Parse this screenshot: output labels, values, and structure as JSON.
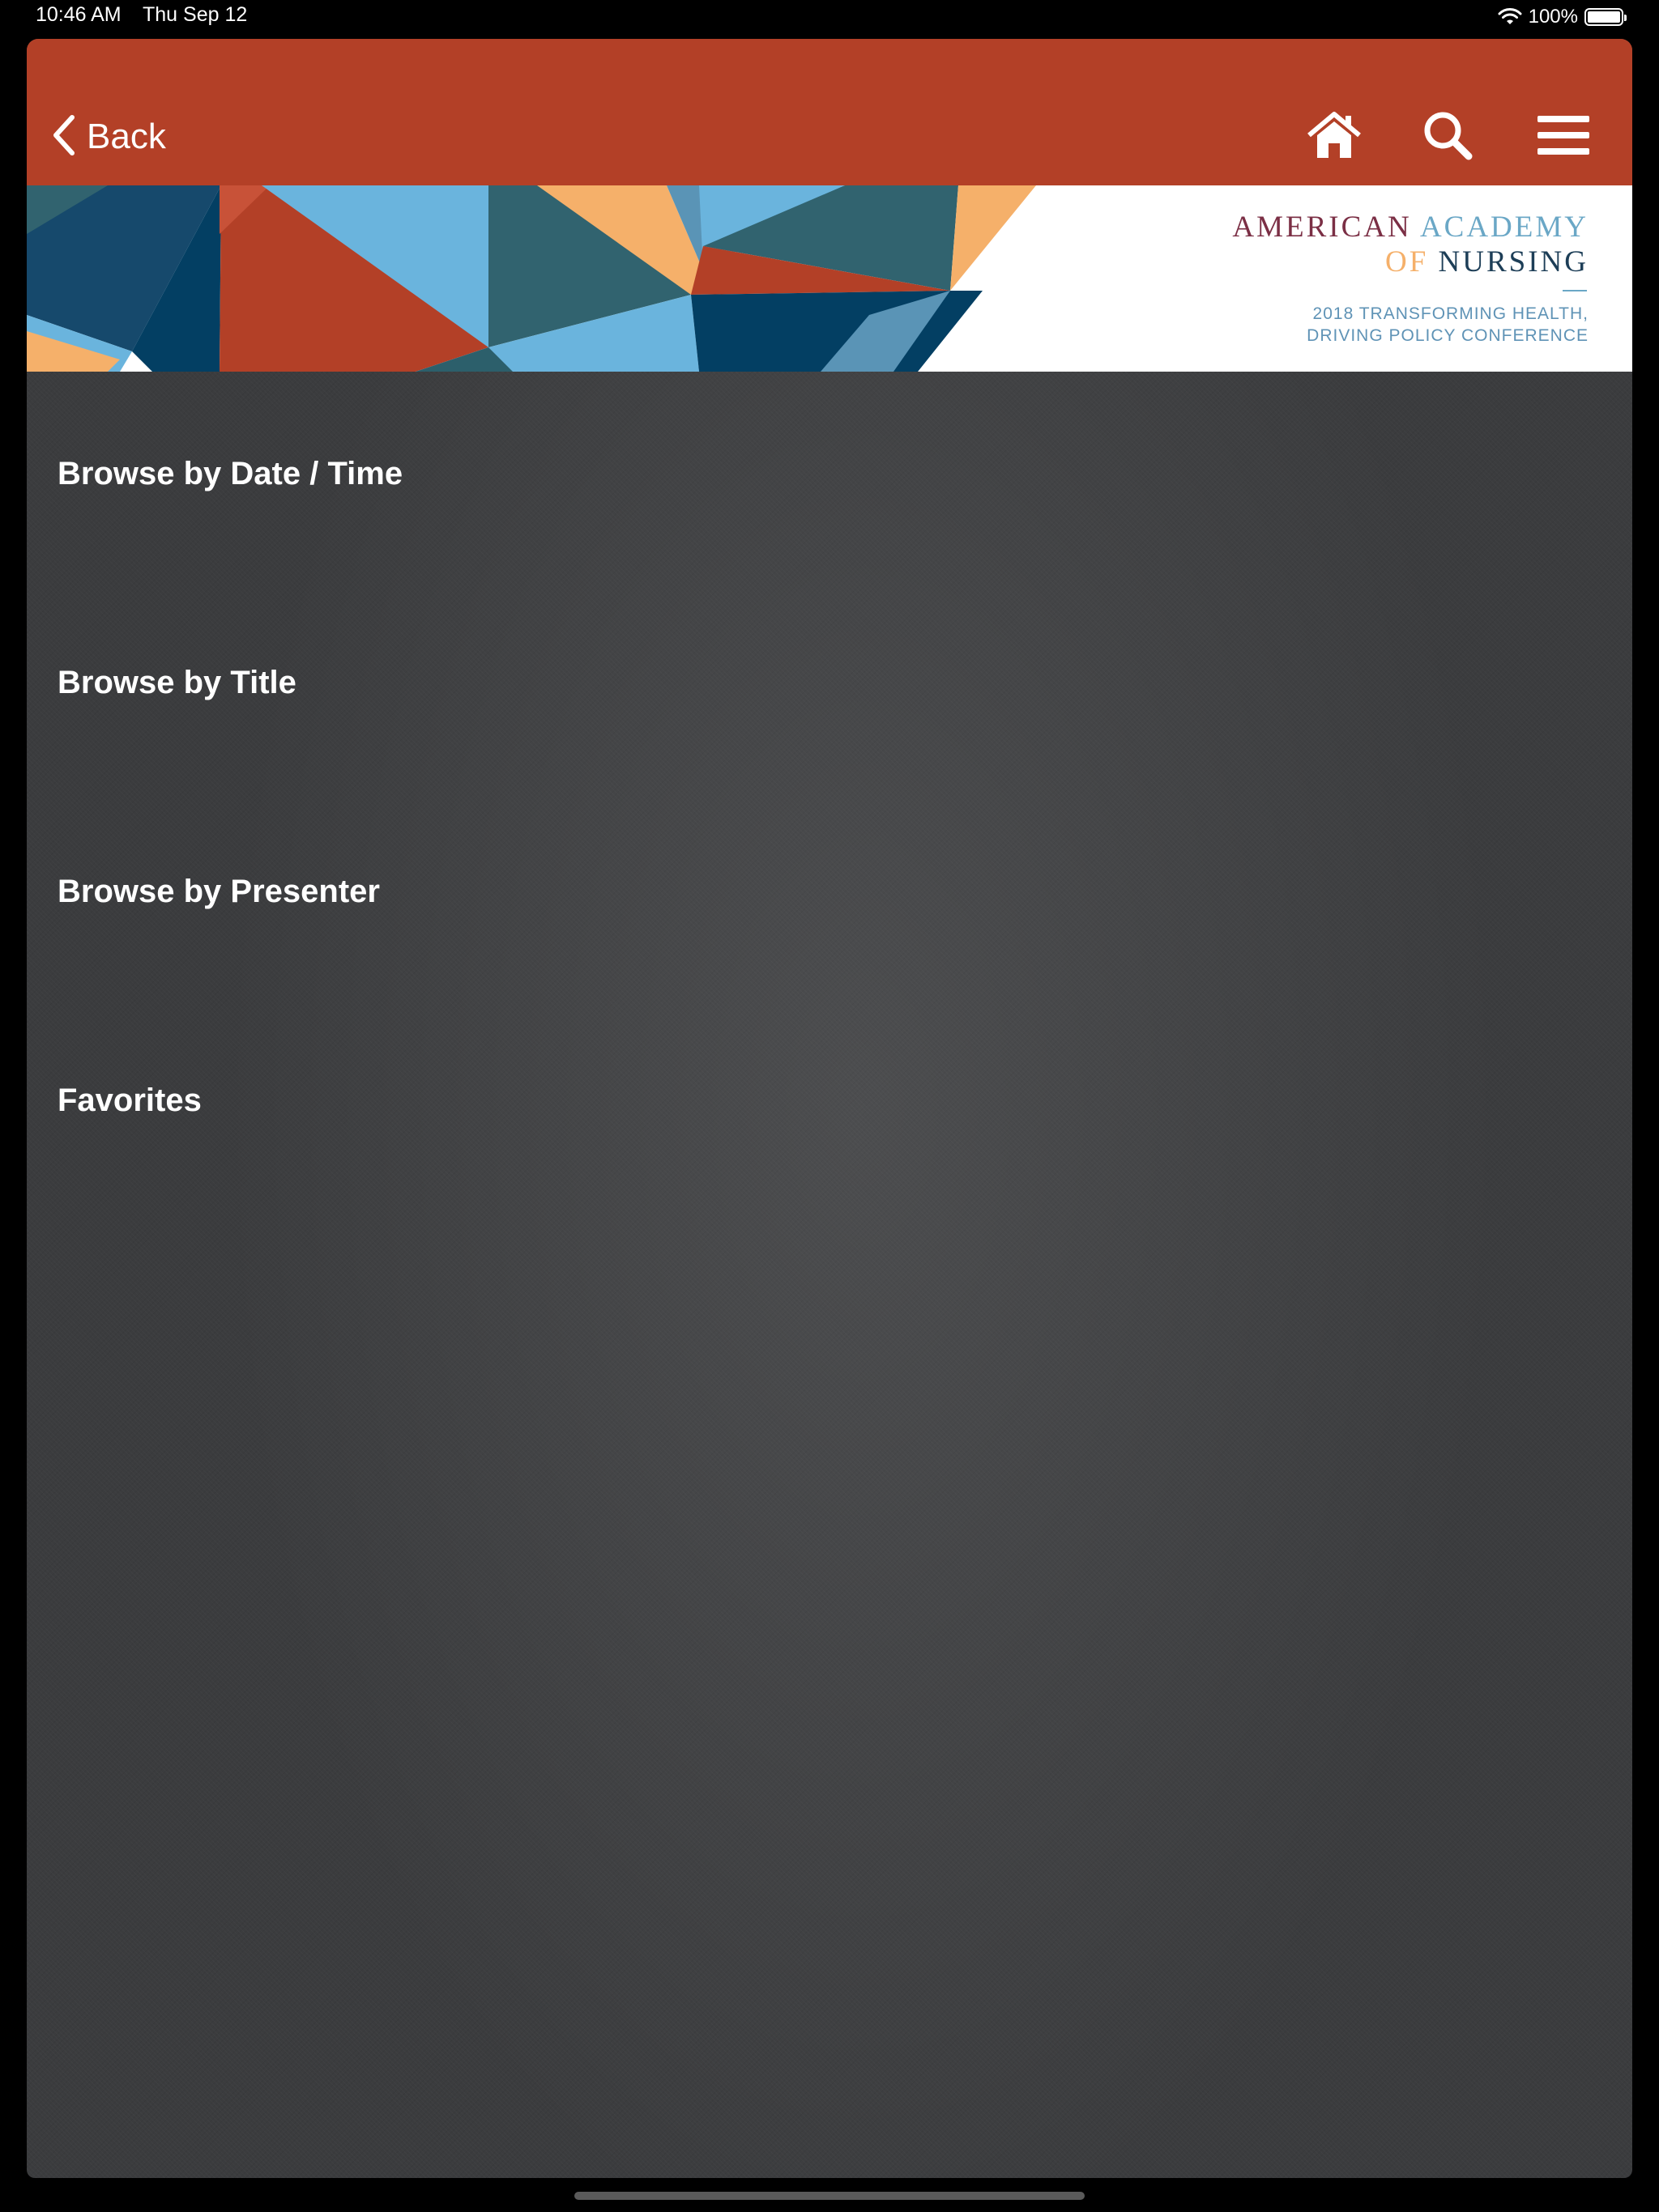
{
  "status_bar": {
    "time": "10:46 AM",
    "date": "Thu Sep 12",
    "battery_percent": "100%",
    "battery_level": 1.0,
    "icons": [
      "wifi-icon",
      "battery-icon"
    ]
  },
  "nav": {
    "back_label": "Back",
    "icons": [
      "chevron-left-icon",
      "home-icon",
      "search-icon",
      "hamburger-menu-icon"
    ],
    "background_color": "#b34027"
  },
  "banner": {
    "org_name_word1": "AMERICAN",
    "org_name_word2": "ACADEMY",
    "org_name_word3": "OF",
    "org_name_word4": "NURSING",
    "tagline_line1": "2018 TRANSFORMING HEALTH,",
    "tagline_line2": "DRIVING POLICY CONFERENCE",
    "colors": {
      "burgundy": "#7b2f45",
      "light_blue": "#6aa7c6",
      "gold": "#f5b06a",
      "navy": "#1d3e57",
      "rust": "#b34027",
      "teal": "#31636f"
    }
  },
  "menu": {
    "items": [
      {
        "label": "Browse by Date / Time"
      },
      {
        "label": "Browse by Title"
      },
      {
        "label": "Browse by Presenter"
      },
      {
        "label": "Favorites"
      }
    ]
  }
}
